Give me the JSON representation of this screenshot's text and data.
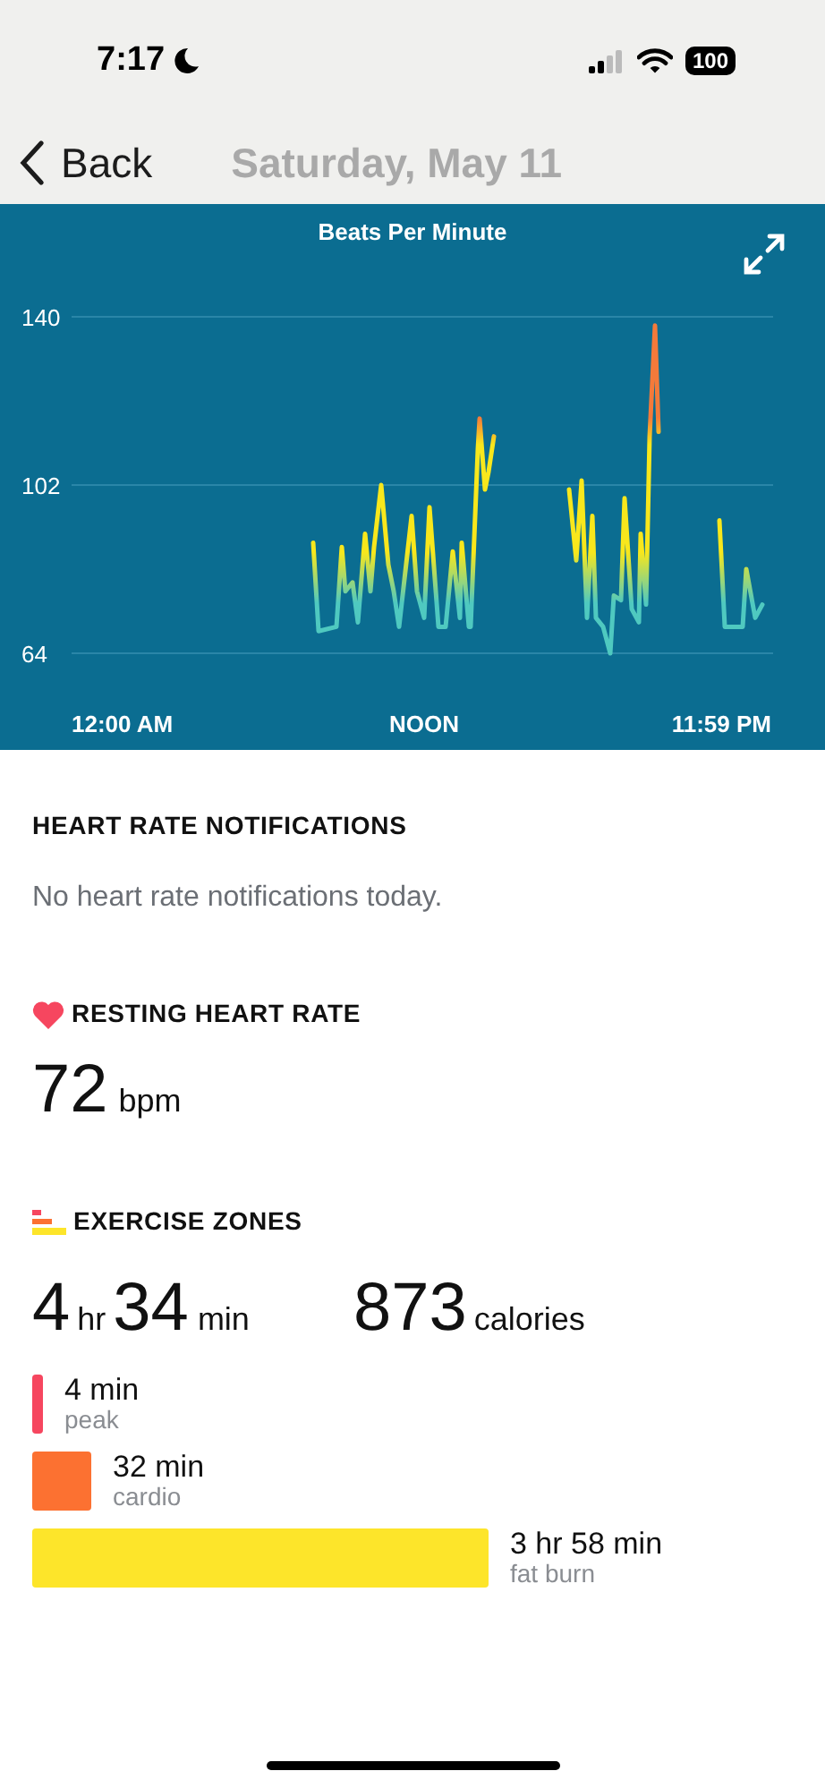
{
  "status_bar": {
    "time": "7:17",
    "battery": "100"
  },
  "nav": {
    "back": "Back",
    "title": "Saturday, May 11"
  },
  "heart_chart": {
    "title": "Beats Per Minute",
    "y_labels": [
      "140",
      "102",
      "64"
    ],
    "x_labels": [
      "12:00 AM",
      "NOON",
      "11:59 PM"
    ]
  },
  "notifications": {
    "heading": "HEART RATE NOTIFICATIONS",
    "message": "No heart rate notifications today."
  },
  "resting": {
    "heading": "RESTING HEART RATE",
    "value": "72",
    "unit": "bpm"
  },
  "exercise": {
    "heading": "EXERCISE ZONES",
    "hours": "4",
    "hours_unit": "hr",
    "minutes": "34",
    "minutes_unit": "min",
    "calories": "873",
    "calories_unit": "calories",
    "zones": [
      {
        "duration": "4 min",
        "name": "peak",
        "color": "#f6465f"
      },
      {
        "duration": "32 min",
        "name": "cardio",
        "color": "#fc7131"
      },
      {
        "duration": "3 hr 58 min",
        "name": "fat burn",
        "color": "#fde52a"
      }
    ]
  }
}
